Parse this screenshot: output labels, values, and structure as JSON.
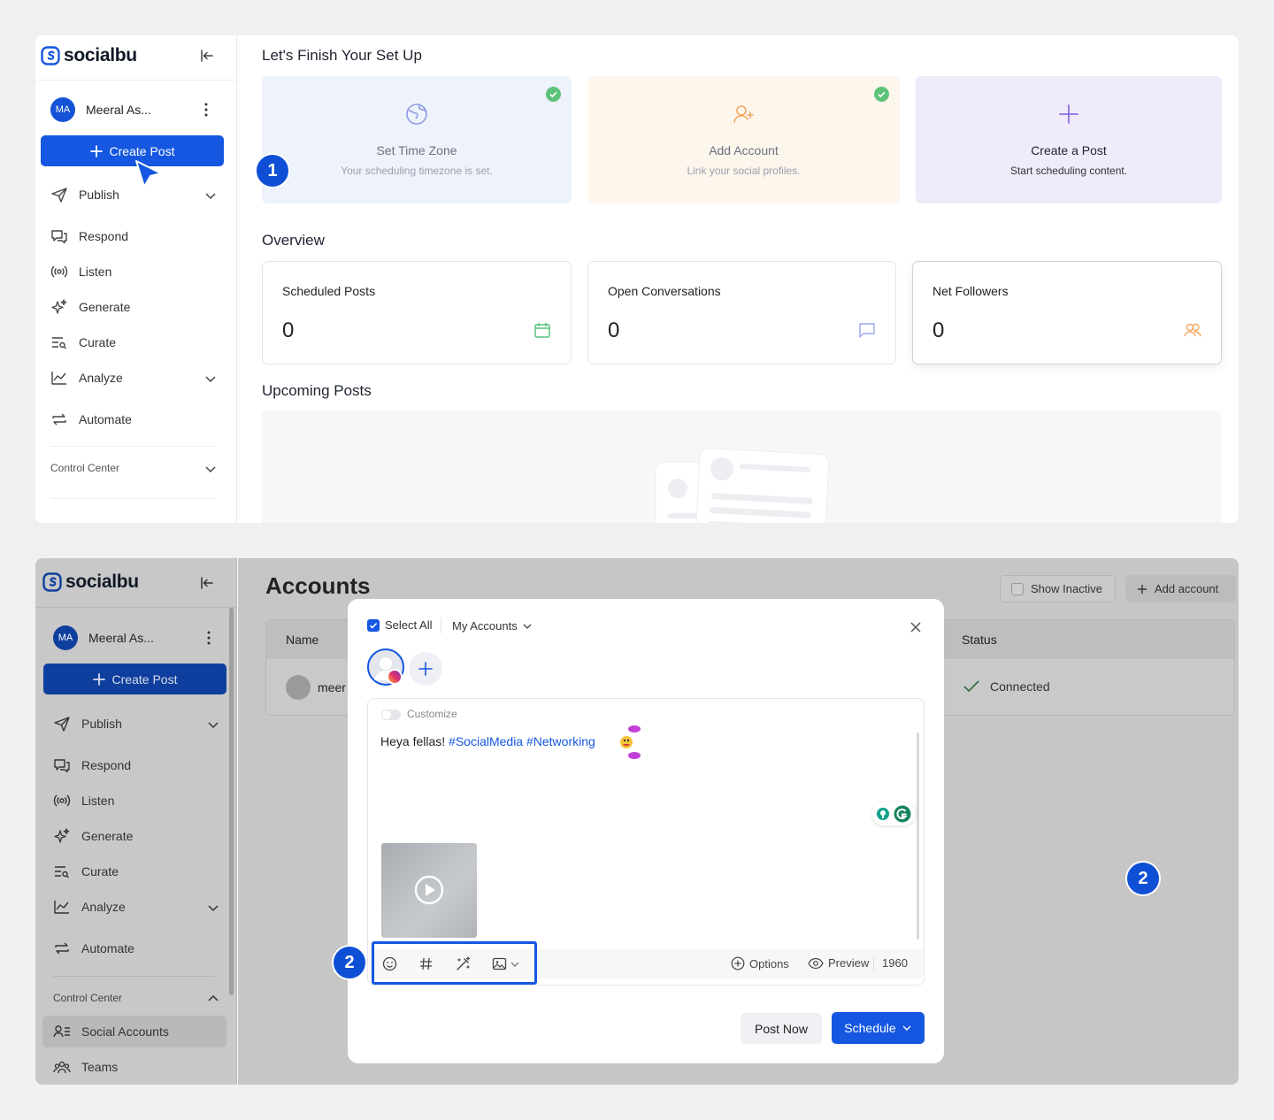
{
  "brand": {
    "name": "socialbu",
    "accent": "#1557e0"
  },
  "user": {
    "initials": "MA",
    "name": "Meeral As..."
  },
  "sidebar": {
    "create_post": "Create Post",
    "items": [
      {
        "label": "Publish",
        "icon": "send-icon",
        "has_chevron": true
      },
      {
        "label": "Respond",
        "icon": "chat-icon",
        "has_chevron": false
      },
      {
        "label": "Listen",
        "icon": "broadcast-icon",
        "has_chevron": false
      },
      {
        "label": "Generate",
        "icon": "sparkle-icon",
        "has_chevron": false
      },
      {
        "label": "Curate",
        "icon": "curate-icon",
        "has_chevron": false
      },
      {
        "label": "Analyze",
        "icon": "chart-line-icon",
        "has_chevron": true
      },
      {
        "label": "Automate",
        "icon": "repeat-icon",
        "has_chevron": false
      }
    ],
    "control_center": "Control Center",
    "control_items": [
      {
        "label": "Social Accounts",
        "icon": "user-list-icon"
      },
      {
        "label": "Teams",
        "icon": "team-icon"
      }
    ]
  },
  "setup": {
    "title": "Let's Finish Your Set Up",
    "cards": [
      {
        "title": "Set Time Zone",
        "subtitle": "Your scheduling timezone is set.",
        "done": true,
        "icon": "globe-icon"
      },
      {
        "title": "Add Account",
        "subtitle": "Link your social profiles.",
        "done": true,
        "icon": "add-user-icon"
      },
      {
        "title": "Create a Post",
        "subtitle": "Start scheduling content.",
        "done": false,
        "icon": "plus-icon"
      }
    ]
  },
  "overview": {
    "title": "Overview",
    "cards": [
      {
        "label": "Scheduled Posts",
        "value": "0",
        "icon": "calendar-icon"
      },
      {
        "label": "Open Conversations",
        "value": "0",
        "icon": "message-icon"
      },
      {
        "label": "Net Followers",
        "value": "0",
        "icon": "users-icon"
      }
    ]
  },
  "upcoming": {
    "title": "Upcoming Posts"
  },
  "steps": {
    "one": "1",
    "two": "2"
  },
  "accounts": {
    "title": "Accounts",
    "show_inactive": "Show Inactive",
    "add_account": "Add account",
    "columns": {
      "name": "Name",
      "status": "Status"
    },
    "row": {
      "name": "meer",
      "status": "Connected"
    }
  },
  "composer": {
    "select_all": "Select All",
    "my_accounts": "My Accounts",
    "customize": "Customize",
    "text_plain": "Heya fellas! ",
    "hashtags": "#SocialMedia #Networking",
    "options": "Options",
    "preview": "Preview",
    "char_count": "1960",
    "post_now": "Post Now",
    "schedule": "Schedule"
  }
}
